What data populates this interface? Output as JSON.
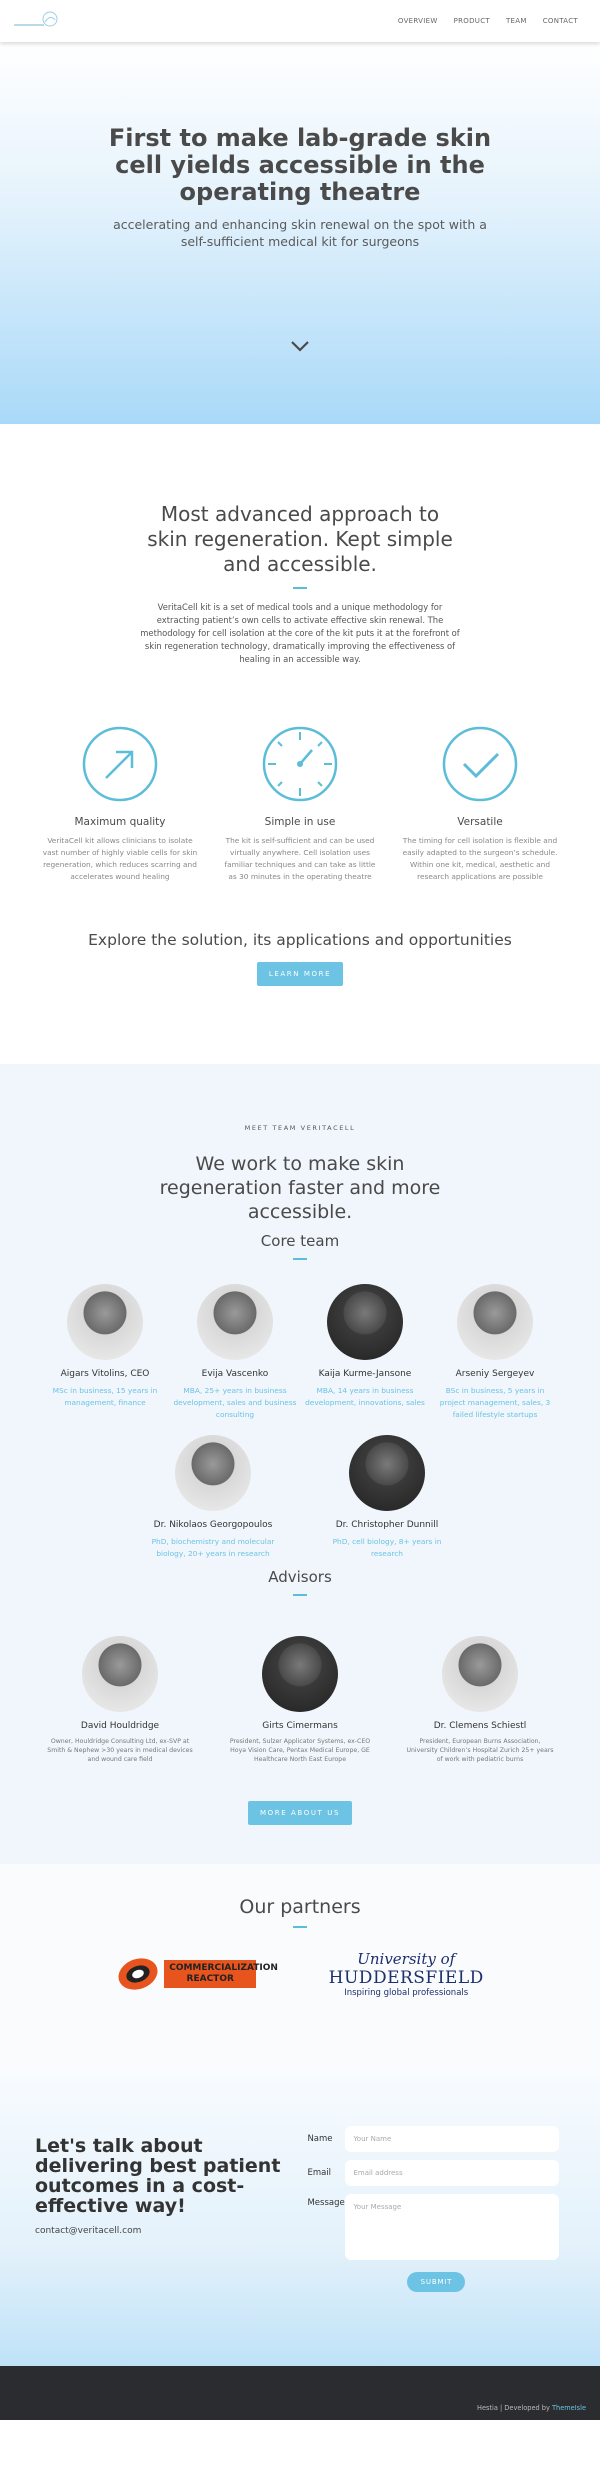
{
  "nav": {
    "links": [
      "OVERVIEW",
      "PRODUCT",
      "TEAM",
      "CONTACT"
    ]
  },
  "hero": {
    "title": "First to make lab-grade skin cell yields accessible in the operating theatre",
    "subtitle": "accelerating and enhancing skin renewal on the spot with a self-sufficient medical kit for surgeons"
  },
  "approach": {
    "title": "Most advanced approach to skin regeneration. Kept simple and accessible.",
    "intro": "VeritaCell kit is a set of medical tools and a unique methodology for extracting patient’s own cells to activate effective skin renewal. The methodology for cell isolation at the core of the kit puts it at the forefront of skin regeneration technology, dramatically improving the effectiveness of healing in an accessible way.",
    "features": [
      {
        "title": "Maximum quality",
        "text": "VeritaCell kit allows clinicians to isolate vast number of highly viable cells for skin regeneration, which reduces scarring and accelerates wound healing",
        "icon": "arrow-circle-icon"
      },
      {
        "title": "Simple in use",
        "text": "The kit is self-sufficient and can be used virtually anywhere. Cell isolation uses familiar techniques and can take as little as 30 minutes in the operating theatre",
        "icon": "timer-dial-icon"
      },
      {
        "title": "Versatile",
        "text": "The timing for cell isolation is flexible and easily adapted to the surgeon’s schedule. Within one kit, medical, aesthetic and research applications are possible",
        "icon": "check-circle-icon"
      }
    ],
    "explore": "Explore the solution, its applications and opportunities",
    "learn_more": "LEARN MORE"
  },
  "team": {
    "kicker": "MEET TEAM VERITACELL",
    "title": "We work to make skin regeneration faster and more accessible.",
    "core_title": "Core team",
    "core": [
      {
        "name": "Aigars Vitolins, CEO",
        "desc": "MSc in business, 15 years in management, finance"
      },
      {
        "name": "Evija Vascenko",
        "desc": "MBA, 25+ years in business development, sales and business consulting"
      },
      {
        "name": "Kaija Kurme-Jansone",
        "desc": "MBA, 14 years in business development, innovations, sales"
      },
      {
        "name": "Arseniy Sergeyev",
        "desc": "BSc in business, 5 years in project management, sales, 3 failed lifestyle startups"
      },
      {
        "name": "Dr. Nikolaos Georgopoulos",
        "desc": "PhD, biochemistry and molecular biology, 20+ years in research"
      },
      {
        "name": "Dr. Christopher Dunnill",
        "desc": "PhD, cell biology, 8+ years in research"
      }
    ],
    "advisors_title": "Advisors",
    "advisors": [
      {
        "name": "David Houldridge",
        "desc": "Owner, Houldridge Consulting Ltd, ex-SVP at Smith & Nephew >30 years in medical devices and wound care field"
      },
      {
        "name": "Girts Cimermans",
        "desc": "President, Sulzer Applicator Systems, ex-CEO Hoya Vision Care, Pentax Medical Europe, GE Healthcare North East Europe"
      },
      {
        "name": "Dr. Clemens Schiestl",
        "desc": "President, European Burns Association, University Children’s Hospital Zurich 25+ years of work with pediatric burns"
      }
    ],
    "more": "MORE ABOUT US"
  },
  "partners": {
    "title": "Our partners",
    "reactor_text": "COMMERCIALIZATION REACTOR",
    "hud_line1": "University of",
    "hud_line2": "HUDDERSFIELD",
    "hud_line3": "Inspiring global professionals"
  },
  "contact": {
    "title": "Let's talk about delivering best patient outcomes in a cost-effective way!",
    "email": "contact@veritacell.com",
    "name_label": "Name",
    "name_ph": "Your Name",
    "email_label": "Email",
    "email_ph": "Email address",
    "msg_label": "Message",
    "msg_ph": "Your Message",
    "submit": "SUBMIT"
  },
  "footer": {
    "left": "Hestia | Developed by ",
    "brand": "ThemeIsle"
  }
}
